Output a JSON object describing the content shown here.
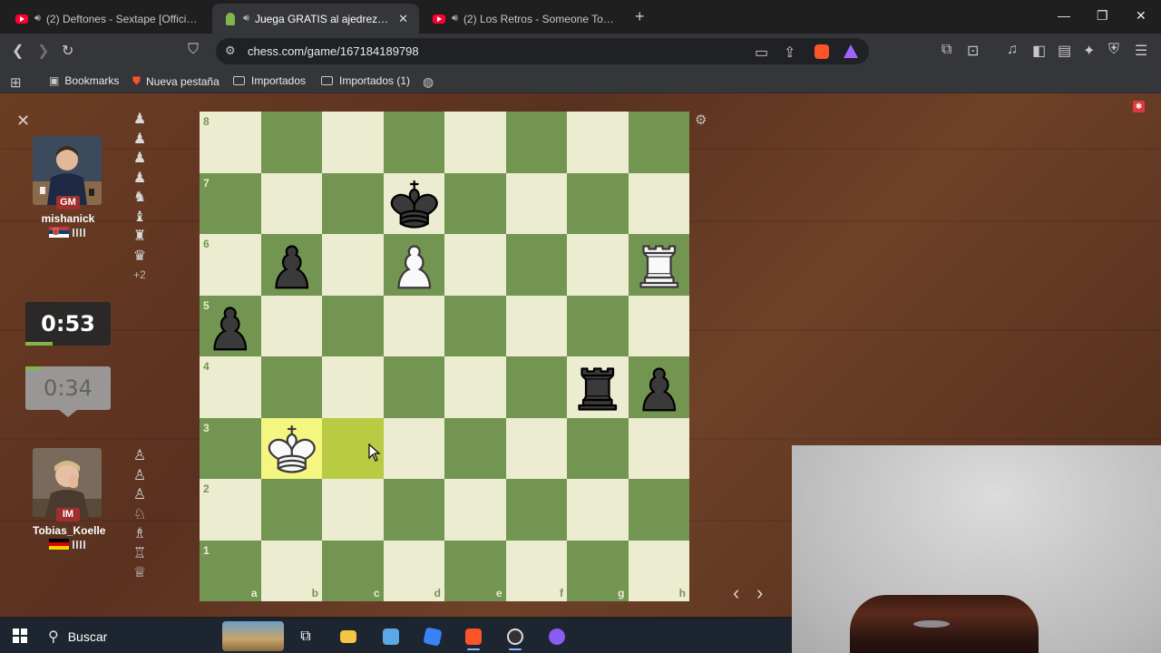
{
  "browser": {
    "tabs": [
      {
        "title": "(2) Deftones - Sextape [Official Music",
        "favicon": "youtube-icon",
        "audio": true,
        "active": false
      },
      {
        "title": "Juega GRATIS al ajedrez online",
        "favicon": "chess-pawn-icon",
        "audio": true,
        "active": true
      },
      {
        "title": "(2) Los Retros - Someone To Spend",
        "favicon": "youtube-icon",
        "audio": true,
        "active": false
      }
    ],
    "new_tab": "+",
    "url": "chess.com/game/167184189798",
    "bookmarks": [
      {
        "label": "Bookmarks",
        "icon": "bookmarks-icon"
      },
      {
        "label": "Nueva pestaña",
        "icon": "brave-icon"
      },
      {
        "label": "Importados",
        "icon": "folder-icon"
      },
      {
        "label": "Importados (1)",
        "icon": "folder-icon"
      }
    ]
  },
  "game": {
    "top_player": {
      "title": "GM",
      "name": "mishanick",
      "country": "Serbia",
      "clock": "0:53",
      "captured": [
        "♟",
        "♟",
        "♟",
        "♟",
        "♞",
        "♝",
        "♜",
        "♛"
      ],
      "advantage": "+2"
    },
    "bottom_player": {
      "title": "IM",
      "name": "Tobias_Koelle",
      "country": "Germany",
      "clock": "0:34",
      "captured": [
        "♙",
        "♙",
        "♙",
        "♘",
        "♗",
        "♖",
        "♕"
      ]
    },
    "files": [
      "a",
      "b",
      "c",
      "d",
      "e",
      "f",
      "g",
      "h"
    ],
    "ranks": [
      "8",
      "7",
      "6",
      "5",
      "4",
      "3",
      "2",
      "1"
    ],
    "highlighted_squares": [
      "b3",
      "c3"
    ],
    "pieces": [
      {
        "square": "d7",
        "piece": "black-king"
      },
      {
        "square": "b6",
        "piece": "black-pawn"
      },
      {
        "square": "d6",
        "piece": "white-pawn"
      },
      {
        "square": "h6",
        "piece": "white-rook"
      },
      {
        "square": "a5",
        "piece": "black-pawn"
      },
      {
        "square": "g4",
        "piece": "black-rook"
      },
      {
        "square": "h4",
        "piece": "black-pawn"
      },
      {
        "square": "b3",
        "piece": "white-king"
      }
    ]
  },
  "taskbar": {
    "search_label": "Buscar",
    "apps": [
      "task-view-icon",
      "file-explorer-icon",
      "notepad-icon",
      "roblox-icon",
      "brave-browser-icon",
      "obs-icon",
      "messenger-icon"
    ]
  }
}
